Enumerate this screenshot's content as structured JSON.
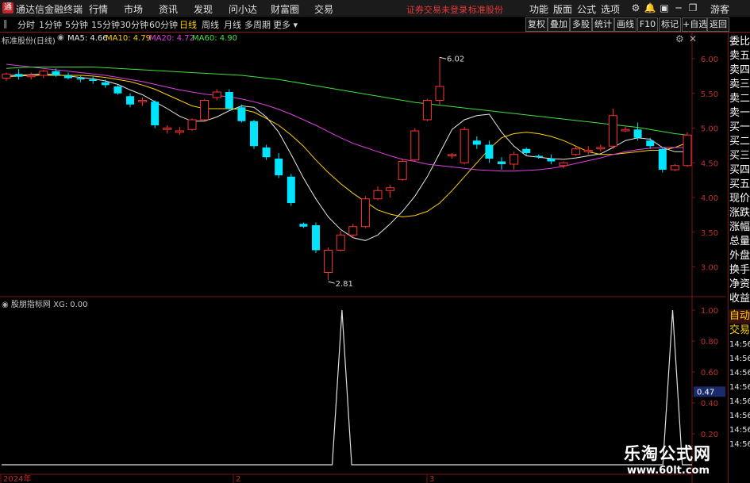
{
  "app": {
    "title": "通达信金融终端",
    "logo_glyph": "通"
  },
  "menu": [
    {
      "label": "行情"
    },
    {
      "label": "市场"
    },
    {
      "label": "资讯"
    },
    {
      "label": "发现"
    },
    {
      "label": "问小达"
    },
    {
      "label": "财富圈"
    },
    {
      "label": "交易"
    }
  ],
  "status": {
    "login": "证券交易未登录",
    "stock": "标准股份"
  },
  "right_menu": [
    {
      "label": "功能"
    },
    {
      "label": "版面"
    },
    {
      "label": "公式"
    },
    {
      "label": "选项"
    }
  ],
  "user": "游客",
  "periods": [
    {
      "label": "分时"
    },
    {
      "label": "1分钟"
    },
    {
      "label": "5分钟"
    },
    {
      "label": "15分钟"
    },
    {
      "label": "30分钟"
    },
    {
      "label": "60分钟"
    },
    {
      "label": "日线",
      "active": true
    },
    {
      "label": "周线"
    },
    {
      "label": "月线"
    },
    {
      "label": "多周期"
    },
    {
      "label": "更多"
    }
  ],
  "toolbar_right": [
    {
      "label": "复权"
    },
    {
      "label": "叠加"
    },
    {
      "label": "多股"
    },
    {
      "label": "统计"
    },
    {
      "label": "画线"
    },
    {
      "label": "F10"
    },
    {
      "label": "标记"
    },
    {
      "label": "+自选"
    },
    {
      "label": "返回"
    }
  ],
  "main_chart": {
    "stock_label": "标准股份(日线)",
    "ma": [
      {
        "label": "MA5: 4.66",
        "color": "#e8e8e8"
      },
      {
        "label": "MA10: 4.79",
        "color": "#ffd200"
      },
      {
        "label": "MA20: 4.72",
        "color": "#e040e0"
      },
      {
        "label": "MA60: 4.90",
        "color": "#40e040"
      }
    ],
    "y_ticks": [
      "6.00",
      "5.50",
      "5.00",
      "4.50",
      "4.00",
      "3.50",
      "3.00"
    ],
    "high_label": "6.02",
    "low_label": "2.81"
  },
  "indicator": {
    "label": "股朋指标网 XG: 0.00",
    "y_ticks": [
      "1.00",
      "0.80",
      "0.60",
      "0.40",
      "0.20"
    ],
    "current_value": "0.47"
  },
  "x_axis": {
    "labels": [
      "2024年",
      "2",
      "3"
    ]
  },
  "sidebar": [
    "委比",
    "卖五",
    "卖四",
    "卖三",
    "卖二",
    "卖一",
    "买一",
    "买二",
    "买三",
    "买四",
    "买五",
    "现价",
    "涨跌",
    "涨幅",
    "总量",
    "外盘",
    "换手",
    "净资",
    "收益",
    "自动",
    "交易",
    "14:56",
    "14:56",
    "14:56",
    "14:56",
    "14:56",
    "14:56",
    "14:56",
    "14:56"
  ],
  "watermark": {
    "main": "乐淘公式网",
    "sub": "www.60lt.com"
  },
  "colors": {
    "up": "#ff3232",
    "down": "#00e5ff",
    "grid_red": "#7a1414"
  },
  "candles": [
    [
      5.72,
      5.8,
      5.68,
      5.78
    ],
    [
      5.78,
      5.85,
      5.7,
      5.74
    ],
    [
      5.74,
      5.8,
      5.7,
      5.76
    ],
    [
      5.76,
      5.84,
      5.72,
      5.82
    ],
    [
      5.82,
      5.86,
      5.74,
      5.76
    ],
    [
      5.76,
      5.8,
      5.7,
      5.72
    ],
    [
      5.72,
      5.76,
      5.66,
      5.7
    ],
    [
      5.7,
      5.74,
      5.64,
      5.68
    ],
    [
      5.66,
      5.7,
      5.58,
      5.62
    ],
    [
      5.6,
      5.62,
      5.48,
      5.5
    ],
    [
      5.46,
      5.5,
      5.3,
      5.34
    ],
    [
      5.38,
      5.44,
      5.32,
      5.4
    ],
    [
      5.38,
      5.4,
      5.0,
      5.04
    ],
    [
      4.98,
      5.04,
      4.92,
      5.0
    ],
    [
      4.94,
      5.02,
      4.9,
      4.96
    ],
    [
      4.98,
      5.14,
      4.96,
      5.12
    ],
    [
      5.12,
      5.42,
      5.1,
      5.4
    ],
    [
      5.44,
      5.56,
      5.4,
      5.52
    ],
    [
      5.52,
      5.56,
      5.26,
      5.28
    ],
    [
      5.3,
      5.34,
      5.08,
      5.1
    ],
    [
      5.1,
      5.12,
      4.7,
      4.74
    ],
    [
      4.72,
      4.76,
      4.54,
      4.58
    ],
    [
      4.56,
      4.64,
      4.28,
      4.32
    ],
    [
      4.3,
      4.34,
      3.88,
      3.92
    ],
    [
      3.62,
      3.64,
      3.56,
      3.58
    ],
    [
      3.6,
      3.64,
      3.2,
      3.24
    ],
    [
      2.92,
      3.28,
      2.81,
      3.24
    ],
    [
      3.24,
      3.52,
      3.22,
      3.46
    ],
    [
      3.46,
      3.62,
      3.42,
      3.58
    ],
    [
      3.58,
      4.02,
      3.56,
      3.98
    ],
    [
      3.98,
      4.16,
      3.96,
      4.1
    ],
    [
      4.1,
      4.18,
      4.0,
      4.14
    ],
    [
      4.26,
      4.56,
      4.24,
      4.52
    ],
    [
      4.54,
      5.0,
      4.52,
      4.96
    ],
    [
      5.12,
      5.42,
      5.1,
      5.4
    ],
    [
      5.4,
      6.02,
      5.34,
      5.6
    ],
    [
      4.6,
      4.64,
      4.56,
      4.62
    ],
    [
      4.5,
      5.02,
      4.48,
      4.98
    ],
    [
      4.82,
      4.88,
      4.7,
      4.76
    ],
    [
      4.76,
      4.82,
      4.5,
      4.56
    ],
    [
      4.52,
      4.58,
      4.4,
      4.48
    ],
    [
      4.48,
      4.66,
      4.4,
      4.62
    ],
    [
      4.7,
      4.72,
      4.6,
      4.64
    ],
    [
      4.6,
      4.62,
      4.56,
      4.58
    ],
    [
      4.56,
      4.62,
      4.48,
      4.52
    ],
    [
      4.46,
      4.52,
      4.42,
      4.5
    ],
    [
      4.62,
      4.74,
      4.6,
      4.7
    ],
    [
      4.66,
      4.74,
      4.62,
      4.68
    ],
    [
      4.7,
      4.76,
      4.66,
      4.72
    ],
    [
      4.74,
      5.28,
      4.7,
      5.18
    ],
    [
      4.96,
      5.02,
      4.94,
      4.98
    ],
    [
      4.98,
      5.08,
      4.82,
      4.86
    ],
    [
      4.82,
      4.86,
      4.7,
      4.74
    ],
    [
      4.7,
      4.72,
      4.36,
      4.4
    ],
    [
      4.4,
      4.48,
      4.38,
      4.46
    ],
    [
      4.46,
      4.94,
      4.44,
      4.9
    ]
  ],
  "ma_lines": {
    "ma5": [
      5.76,
      5.76,
      5.77,
      5.78,
      5.77,
      5.75,
      5.73,
      5.71,
      5.68,
      5.63,
      5.55,
      5.48,
      5.38,
      5.28,
      5.17,
      5.1,
      5.1,
      5.16,
      5.25,
      5.32,
      5.3,
      5.16,
      4.94,
      4.62,
      4.28,
      3.98,
      3.72,
      3.54,
      3.42,
      3.38,
      3.46,
      3.62,
      3.8,
      4.02,
      4.3,
      4.64,
      4.98,
      5.12,
      5.18,
      5.2,
      4.94,
      4.74,
      4.6,
      4.58,
      4.56,
      4.55,
      4.57,
      4.6,
      4.63,
      4.72,
      4.82,
      4.86,
      4.84,
      4.72,
      4.66,
      4.66
    ],
    "ma10": [
      5.74,
      5.75,
      5.76,
      5.76,
      5.76,
      5.76,
      5.76,
      5.75,
      5.73,
      5.7,
      5.67,
      5.62,
      5.56,
      5.48,
      5.4,
      5.32,
      5.28,
      5.28,
      5.28,
      5.27,
      5.23,
      5.14,
      5.04,
      4.9,
      4.74,
      4.54,
      4.36,
      4.2,
      4.06,
      3.94,
      3.82,
      3.76,
      3.72,
      3.74,
      3.8,
      3.92,
      4.1,
      4.3,
      4.5,
      4.7,
      4.86,
      4.92,
      4.94,
      4.92,
      4.88,
      4.82,
      4.74,
      4.66,
      4.62,
      4.62,
      4.64,
      4.66,
      4.68,
      4.68,
      4.72,
      4.79
    ],
    "ma20": [
      5.92,
      5.9,
      5.88,
      5.86,
      5.84,
      5.82,
      5.8,
      5.78,
      5.76,
      5.73,
      5.7,
      5.67,
      5.63,
      5.59,
      5.55,
      5.52,
      5.49,
      5.47,
      5.45,
      5.42,
      5.38,
      5.33,
      5.27,
      5.2,
      5.12,
      5.04,
      4.95,
      4.86,
      4.78,
      4.72,
      4.66,
      4.6,
      4.55,
      4.52,
      4.48,
      4.46,
      4.44,
      4.42,
      4.4,
      4.39,
      4.38,
      4.38,
      4.39,
      4.4,
      4.42,
      4.45,
      4.49,
      4.53,
      4.57,
      4.62,
      4.66,
      4.69,
      4.71,
      4.72,
      4.72,
      4.72
    ],
    "ma60": [
      5.86,
      5.87,
      5.88,
      5.88,
      5.88,
      5.88,
      5.88,
      5.88,
      5.87,
      5.86,
      5.85,
      5.84,
      5.83,
      5.82,
      5.81,
      5.8,
      5.79,
      5.78,
      5.77,
      5.76,
      5.74,
      5.72,
      5.7,
      5.67,
      5.64,
      5.61,
      5.58,
      5.55,
      5.52,
      5.49,
      5.46,
      5.43,
      5.4,
      5.37,
      5.35,
      5.33,
      5.31,
      5.29,
      5.27,
      5.25,
      5.23,
      5.21,
      5.19,
      5.17,
      5.15,
      5.13,
      5.11,
      5.09,
      5.07,
      5.05,
      5.03,
      5.01,
      4.98,
      4.95,
      4.92,
      4.9
    ]
  },
  "xg_signal": [
    0,
    0,
    0,
    0,
    0,
    0,
    0,
    0,
    0,
    0,
    0,
    0,
    0,
    0,
    0,
    0,
    0,
    0,
    0,
    0,
    0,
    0,
    0,
    0,
    0,
    0,
    0,
    0,
    0,
    0,
    0,
    0,
    0,
    0,
    0,
    1,
    0,
    0,
    0,
    0,
    0,
    0,
    0,
    0,
    0,
    0,
    0,
    0,
    0,
    0,
    0,
    0,
    0,
    0,
    0,
    0,
    0,
    0,
    0,
    0,
    0,
    0,
    0,
    0,
    0,
    0,
    0,
    0,
    0,
    1,
    0,
    0
  ]
}
